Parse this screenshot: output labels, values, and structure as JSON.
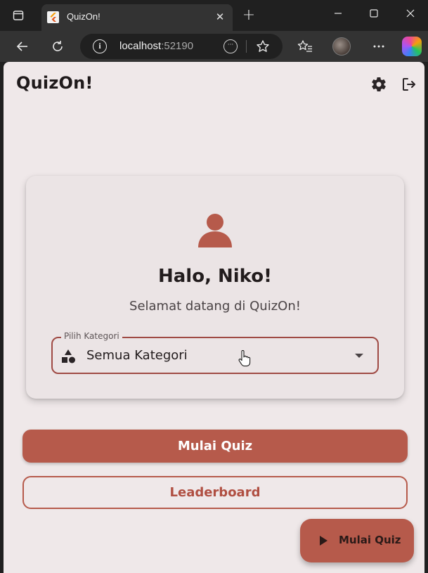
{
  "browser": {
    "tab_title": "QuizOn!",
    "tab_close": "✕",
    "new_tab": "+",
    "address_host": "localhost",
    "address_port": ":52190"
  },
  "app": {
    "title": "QuizOn!"
  },
  "card": {
    "greeting": "Halo, Niko!",
    "welcome": "Selamat datang di QuizOn!",
    "category_label": "Pilih Kategori",
    "category_value": "Semua Kategori"
  },
  "actions": {
    "start_quiz": "Mulai Quiz",
    "leaderboard": "Leaderboard",
    "fab_label": "Mulai Quiz"
  },
  "colors": {
    "accent": "#b65a4b",
    "page_background": "#efe8e9",
    "card_background": "#ebe4e5",
    "chrome_dark": "#202020",
    "chrome_toolbar": "#333333"
  },
  "icons": {
    "sidebar_toggle": "sidebar-icon",
    "favicon": "flutter-icon",
    "back": "back-arrow-icon",
    "refresh": "refresh-icon",
    "site_info": "info-icon",
    "reader": "reader-mode-icon",
    "favorite": "star-icon",
    "favorites_list": "favorites-icon",
    "more": "more-icon",
    "copilot": "copilot-icon",
    "settings": "gear-icon",
    "logout": "logout-icon",
    "user": "person-icon",
    "category": "category-shapes-icon",
    "dropdown": "dropdown-arrow-icon",
    "play": "play-icon"
  }
}
